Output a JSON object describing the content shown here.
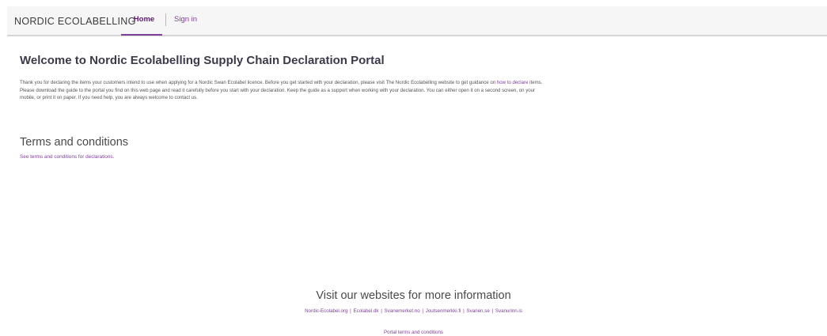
{
  "nav": {
    "brand": "NORDIC ECOLABELLING",
    "home": "Home",
    "sign_in": "Sign in"
  },
  "welcome": {
    "title": "Welcome to Nordic Ecolabelling Supply Chain Declaration Portal",
    "intro_part1": "Thank you for declaring the items your customers intend to use when applying for a Nordic Swan Ecolabel licence. Before you get started with your declaration, please visit The Nordic Ecolabelling website to get guidance on ",
    "intro_link": "how to declare",
    "intro_part2": " items. Please download the guide to the portal you find on this web page and read it carefully before you start with your declaration. Keep the guide as a support when working with your declaration. You can either open it on a second screen, on your mobile, or print it on paper. If you need help, you are always welcome to contact us."
  },
  "terms": {
    "heading": "Terms and conditions",
    "link": "See terms and conditions for declarations."
  },
  "footer": {
    "heading": "Visit our websites for more information",
    "links": [
      "Nordic-Ecolabel.org",
      "Ecolabel.dk",
      "Svanemerket.no",
      "Joutsenmerkki.fi",
      "Svanen.se",
      "Svanurinn.is"
    ],
    "separator": "|",
    "portal_terms": "Portal terms and conditions"
  },
  "colors": {
    "accent": "#7d3f98",
    "navbar_bg": "#f6f6f6",
    "heading": "#3a3a4a"
  }
}
